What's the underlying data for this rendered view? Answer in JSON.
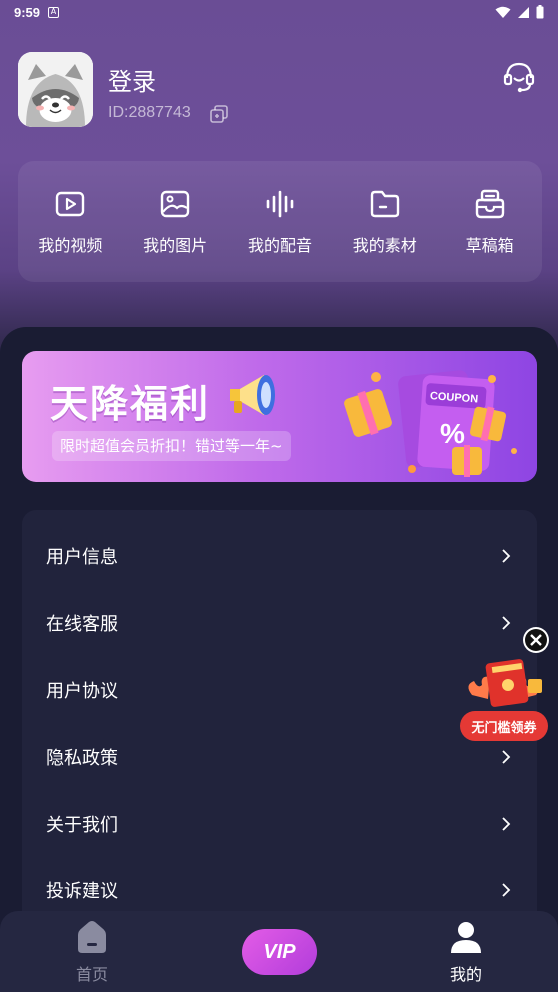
{
  "status_bar": {
    "time": "9:59",
    "notification_icon": "A"
  },
  "profile": {
    "login_label": "登录",
    "user_id": "ID:2887743"
  },
  "quick_actions": [
    {
      "label": "我的视频",
      "icon": "video-icon"
    },
    {
      "label": "我的图片",
      "icon": "image-icon"
    },
    {
      "label": "我的配音",
      "icon": "audio-wave-icon"
    },
    {
      "label": "我的素材",
      "icon": "folder-icon"
    },
    {
      "label": "草稿箱",
      "icon": "draft-box-icon"
    }
  ],
  "banner": {
    "title": "天降福利",
    "subtitle": "限时超值会员折扣！错过等一年~",
    "coupon_text": "COUPON"
  },
  "menu": [
    {
      "label": "用户信息"
    },
    {
      "label": "在线客服"
    },
    {
      "label": "用户协议"
    },
    {
      "label": "隐私政策"
    },
    {
      "label": "关于我们"
    },
    {
      "label": "投诉建议"
    }
  ],
  "float_promo": {
    "label": "无门槛领券"
  },
  "bottom_nav": {
    "home_label": "首页",
    "vip_label": "VIP",
    "mine_label": "我的"
  },
  "colors": {
    "accent": "#c06bea",
    "background": "#1a1c33",
    "card": "#21233c",
    "promo_red": "#e53935"
  }
}
